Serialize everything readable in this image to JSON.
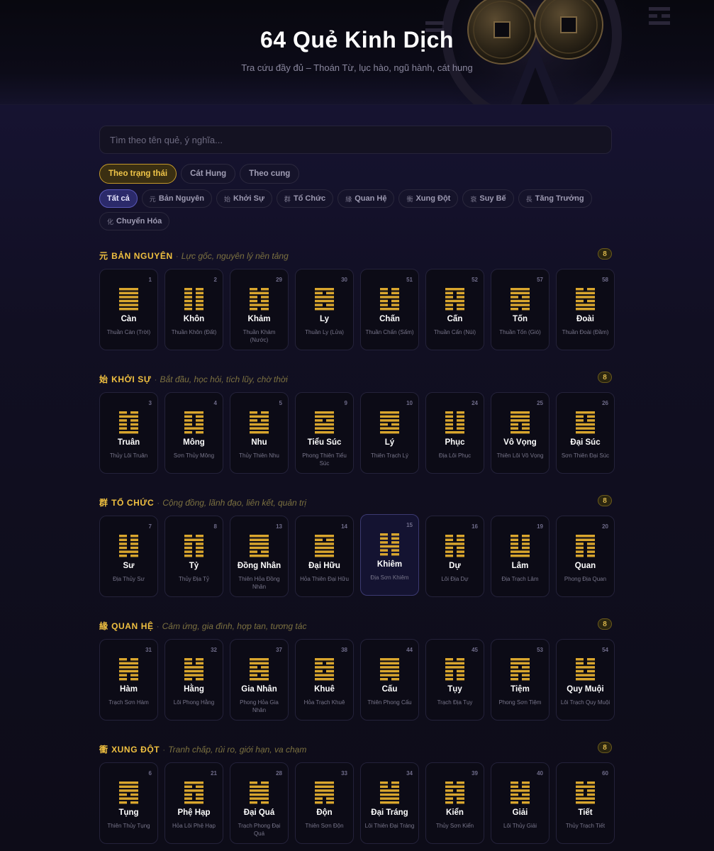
{
  "colors": {
    "accent": "#f0c040",
    "yang_yin_line": "#d9a62e",
    "active_chip": "#2b2a6a"
  },
  "header": {
    "title": "64 Quẻ Kinh Dịch",
    "subtitle": "Tra cứu đầy đủ – Thoán Từ, lục hào, ngũ hành, cát hung"
  },
  "search": {
    "placeholder": "Tìm theo tên quẻ, ý nghĩa...",
    "value": ""
  },
  "tabs": [
    {
      "label": "Theo trạng thái",
      "active": true
    },
    {
      "label": "Cát Hung",
      "active": false
    },
    {
      "label": "Theo cung",
      "active": false
    }
  ],
  "filters": [
    {
      "glyph": "",
      "label": "Tất cả",
      "active": true
    },
    {
      "glyph": "元",
      "label": "Bản Nguyên",
      "active": false
    },
    {
      "glyph": "始",
      "label": "Khởi Sự",
      "active": false
    },
    {
      "glyph": "群",
      "label": "Tổ Chức",
      "active": false
    },
    {
      "glyph": "緣",
      "label": "Quan Hệ",
      "active": false
    },
    {
      "glyph": "衝",
      "label": "Xung Đột",
      "active": false
    },
    {
      "glyph": "衰",
      "label": "Suy Bế",
      "active": false
    },
    {
      "glyph": "長",
      "label": "Tăng Trưởng",
      "active": false
    },
    {
      "glyph": "化",
      "label": "Chuyển Hóa",
      "active": false
    }
  ],
  "sections": [
    {
      "glyph": "元",
      "title": "BẢN NGUYÊN",
      "desc": "Lực gốc, nguyên lý nền tảng",
      "count": "8",
      "cards": [
        {
          "num": "1",
          "name": "Càn",
          "sub": "Thuần Càn (Trời)",
          "lines": [
            1,
            1,
            1,
            1,
            1,
            1
          ]
        },
        {
          "num": "2",
          "name": "Khôn",
          "sub": "Thuần Khôn (Đất)",
          "lines": [
            0,
            0,
            0,
            0,
            0,
            0
          ]
        },
        {
          "num": "29",
          "name": "Khảm",
          "sub": "Thuần Khảm (Nước)",
          "lines": [
            0,
            1,
            0,
            0,
            1,
            0
          ]
        },
        {
          "num": "30",
          "name": "Ly",
          "sub": "Thuần Ly (Lửa)",
          "lines": [
            1,
            0,
            1,
            1,
            0,
            1
          ]
        },
        {
          "num": "51",
          "name": "Chấn",
          "sub": "Thuần Chấn (Sấm)",
          "lines": [
            0,
            0,
            1,
            0,
            0,
            1
          ]
        },
        {
          "num": "52",
          "name": "Cấn",
          "sub": "Thuần Cấn (Núi)",
          "lines": [
            1,
            0,
            0,
            1,
            0,
            0
          ]
        },
        {
          "num": "57",
          "name": "Tốn",
          "sub": "Thuần Tốn (Gió)",
          "lines": [
            1,
            1,
            0,
            1,
            1,
            0
          ]
        },
        {
          "num": "58",
          "name": "Đoài",
          "sub": "Thuần Đoài (Đầm)",
          "lines": [
            0,
            1,
            1,
            0,
            1,
            1
          ]
        }
      ]
    },
    {
      "glyph": "始",
      "title": "KHỞI SỰ",
      "desc": "Bắt đầu, học hỏi, tích lũy, chờ thời",
      "count": "8",
      "cards": [
        {
          "num": "3",
          "name": "Truân",
          "sub": "Thủy Lôi Truân",
          "lines": [
            0,
            1,
            0,
            0,
            0,
            1
          ]
        },
        {
          "num": "4",
          "name": "Mông",
          "sub": "Sơn Thủy Mông",
          "lines": [
            1,
            0,
            0,
            0,
            1,
            0
          ]
        },
        {
          "num": "5",
          "name": "Nhu",
          "sub": "Thủy Thiên Nhu",
          "lines": [
            0,
            1,
            0,
            1,
            1,
            1
          ]
        },
        {
          "num": "9",
          "name": "Tiểu Súc",
          "sub": "Phong Thiên Tiểu Súc",
          "lines": [
            1,
            1,
            0,
            1,
            1,
            1
          ]
        },
        {
          "num": "10",
          "name": "Lý",
          "sub": "Thiên Trạch Lý",
          "lines": [
            1,
            1,
            1,
            0,
            1,
            1
          ]
        },
        {
          "num": "24",
          "name": "Phục",
          "sub": "Địa Lôi Phục",
          "lines": [
            0,
            0,
            0,
            0,
            0,
            1
          ]
        },
        {
          "num": "25",
          "name": "Vô Vọng",
          "sub": "Thiên Lôi Vô Vọng",
          "lines": [
            1,
            1,
            1,
            0,
            0,
            1
          ]
        },
        {
          "num": "26",
          "name": "Đại Súc",
          "sub": "Sơn Thiên Đại Súc",
          "lines": [
            1,
            0,
            0,
            1,
            1,
            1
          ]
        }
      ]
    },
    {
      "glyph": "群",
      "title": "TỔ CHỨC",
      "desc": "Cộng đồng, lãnh đạo, liên kết, quản trị",
      "count": "8",
      "cards": [
        {
          "num": "7",
          "name": "Sư",
          "sub": "Địa Thủy Sư",
          "lines": [
            0,
            0,
            0,
            0,
            1,
            0
          ]
        },
        {
          "num": "8",
          "name": "Tỷ",
          "sub": "Thủy Địa Tỷ",
          "lines": [
            0,
            1,
            0,
            0,
            0,
            0
          ]
        },
        {
          "num": "13",
          "name": "Đồng Nhân",
          "sub": "Thiên Hỏa Đồng Nhân",
          "lines": [
            1,
            1,
            1,
            1,
            0,
            1
          ]
        },
        {
          "num": "14",
          "name": "Đại Hữu",
          "sub": "Hỏa Thiên Đại Hữu",
          "lines": [
            1,
            0,
            1,
            1,
            1,
            1
          ]
        },
        {
          "num": "15",
          "name": "Khiêm",
          "sub": "Địa Sơn Khiêm",
          "lines": [
            0,
            0,
            0,
            1,
            0,
            0
          ],
          "highlight": true
        },
        {
          "num": "16",
          "name": "Dự",
          "sub": "Lôi Địa Dự",
          "lines": [
            0,
            0,
            1,
            0,
            0,
            0
          ]
        },
        {
          "num": "19",
          "name": "Lâm",
          "sub": "Địa Trạch Lâm",
          "lines": [
            0,
            0,
            0,
            0,
            1,
            1
          ]
        },
        {
          "num": "20",
          "name": "Quan",
          "sub": "Phong Địa Quan",
          "lines": [
            1,
            1,
            0,
            0,
            0,
            0
          ]
        }
      ]
    },
    {
      "glyph": "緣",
      "title": "QUAN HỆ",
      "desc": "Cảm ứng, gia đình, hợp tan, tương tác",
      "count": "8",
      "cards": [
        {
          "num": "31",
          "name": "Hàm",
          "sub": "Trạch Sơn Hàm",
          "lines": [
            0,
            1,
            1,
            1,
            0,
            0
          ]
        },
        {
          "num": "32",
          "name": "Hằng",
          "sub": "Lôi Phong Hằng",
          "lines": [
            0,
            0,
            1,
            1,
            1,
            0
          ]
        },
        {
          "num": "37",
          "name": "Gia Nhân",
          "sub": "Phong Hỏa Gia Nhân",
          "lines": [
            1,
            1,
            0,
            1,
            0,
            1
          ]
        },
        {
          "num": "38",
          "name": "Khuê",
          "sub": "Hỏa Trạch Khuê",
          "lines": [
            1,
            0,
            1,
            0,
            1,
            1
          ]
        },
        {
          "num": "44",
          "name": "Cấu",
          "sub": "Thiên Phong Cấu",
          "lines": [
            1,
            1,
            1,
            1,
            1,
            0
          ]
        },
        {
          "num": "45",
          "name": "Tụy",
          "sub": "Trạch Địa Tụy",
          "lines": [
            0,
            1,
            1,
            0,
            0,
            0
          ]
        },
        {
          "num": "53",
          "name": "Tiệm",
          "sub": "Phong Sơn Tiệm",
          "lines": [
            1,
            1,
            0,
            1,
            0,
            0
          ]
        },
        {
          "num": "54",
          "name": "Quy Muội",
          "sub": "Lôi Trạch Quy Muội",
          "lines": [
            0,
            0,
            1,
            0,
            1,
            1
          ]
        }
      ]
    },
    {
      "glyph": "衝",
      "title": "XUNG ĐỘT",
      "desc": "Tranh chấp, rủi ro, giới hạn, va chạm",
      "count": "8",
      "cards": [
        {
          "num": "6",
          "name": "Tụng",
          "sub": "Thiên Thủy Tụng",
          "lines": [
            1,
            1,
            1,
            0,
            1,
            0
          ]
        },
        {
          "num": "21",
          "name": "Phệ Hạp",
          "sub": "Hỏa Lôi Phệ Hạp",
          "lines": [
            1,
            0,
            1,
            0,
            0,
            1
          ]
        },
        {
          "num": "28",
          "name": "Đại Quá",
          "sub": "Trạch Phong Đại Quá",
          "lines": [
            0,
            1,
            1,
            1,
            1,
            0
          ]
        },
        {
          "num": "33",
          "name": "Độn",
          "sub": "Thiên Sơn Độn",
          "lines": [
            1,
            1,
            1,
            1,
            0,
            0
          ]
        },
        {
          "num": "34",
          "name": "Đại Tráng",
          "sub": "Lôi Thiên Đại Tráng",
          "lines": [
            0,
            0,
            1,
            1,
            1,
            1
          ]
        },
        {
          "num": "39",
          "name": "Kiển",
          "sub": "Thủy Sơn Kiển",
          "lines": [
            0,
            1,
            0,
            1,
            0,
            0
          ]
        },
        {
          "num": "40",
          "name": "Giải",
          "sub": "Lôi Thủy Giải",
          "lines": [
            0,
            0,
            1,
            0,
            1,
            0
          ]
        },
        {
          "num": "60",
          "name": "Tiết",
          "sub": "Thủy Trạch Tiết",
          "lines": [
            0,
            1,
            0,
            0,
            1,
            1
          ]
        }
      ]
    }
  ]
}
